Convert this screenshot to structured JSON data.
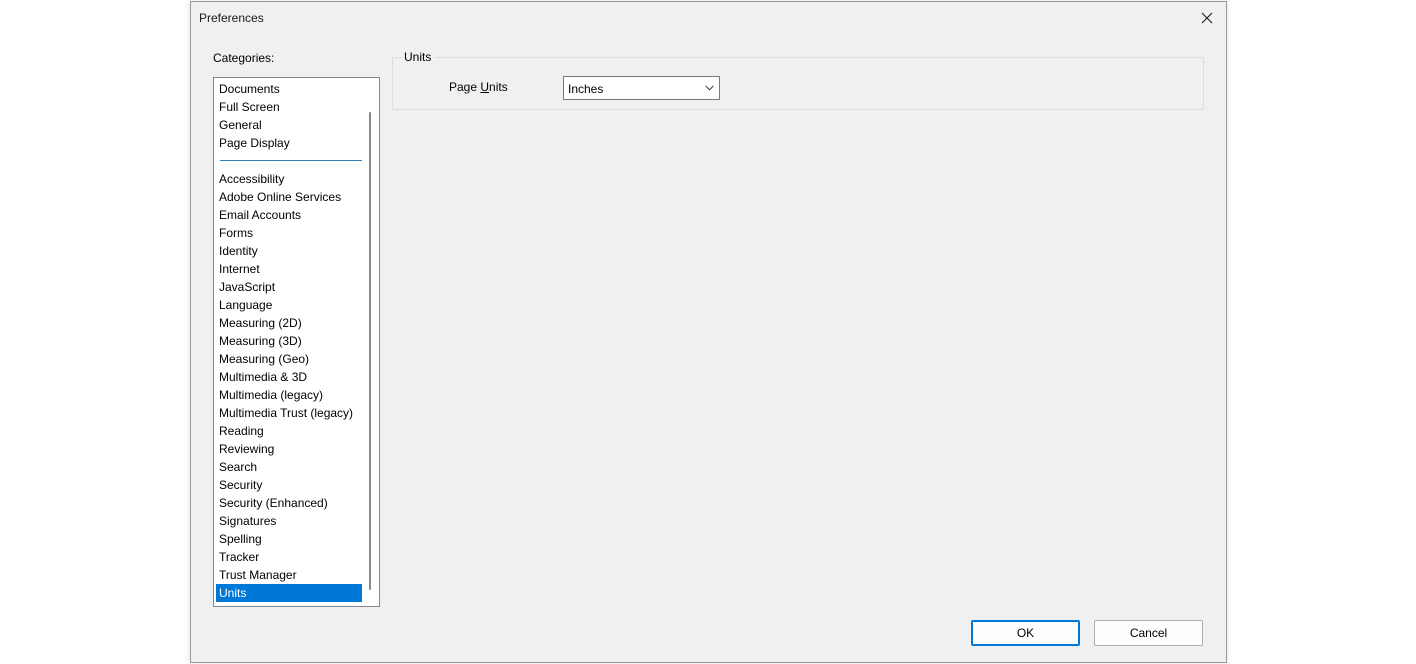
{
  "window": {
    "title": "Preferences"
  },
  "categories": {
    "label": "Categories:",
    "top_items": [
      "Documents",
      "Full Screen",
      "General",
      "Page Display"
    ],
    "items": [
      "Accessibility",
      "Adobe Online Services",
      "Email Accounts",
      "Forms",
      "Identity",
      "Internet",
      "JavaScript",
      "Language",
      "Measuring (2D)",
      "Measuring (3D)",
      "Measuring (Geo)",
      "Multimedia & 3D",
      "Multimedia (legacy)",
      "Multimedia Trust (legacy)",
      "Reading",
      "Reviewing",
      "Search",
      "Security",
      "Security (Enhanced)",
      "Signatures",
      "Spelling",
      "Tracker",
      "Trust Manager",
      "Units"
    ],
    "selected": "Units"
  },
  "units_group": {
    "title": "Units",
    "page_units_label_prefix": "Page ",
    "page_units_label_accel": "U",
    "page_units_label_suffix": "nits",
    "page_units_value": "Inches"
  },
  "buttons": {
    "ok": "OK",
    "cancel": "Cancel"
  },
  "colors": {
    "selection": "#0078d7",
    "dialog_bg": "#f0f0f0",
    "separator": "#2f7fba"
  }
}
